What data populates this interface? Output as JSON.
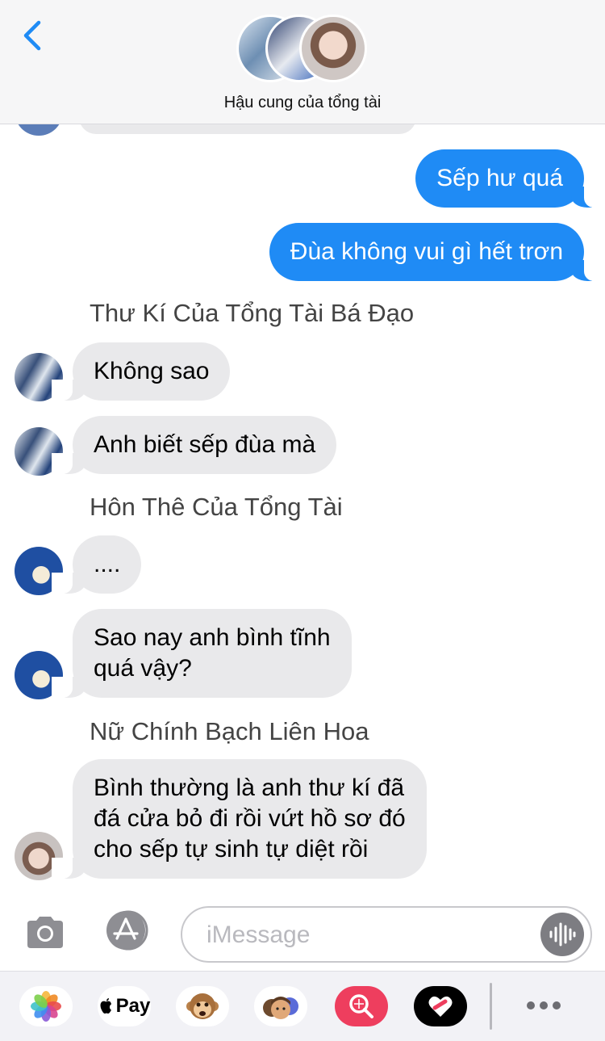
{
  "header": {
    "title": "Hậu cung của tổng tài",
    "back_icon": "chevron-left-icon",
    "accent_color": "#1f8bf5"
  },
  "messages": {
    "sent_1": "Sếp hư quá",
    "sent_2": "Đùa không vui gì hết trơn",
    "sender_1": "Thư Kí Của Tổng Tài Bá Đạo",
    "recv_1": "Không sao",
    "recv_2": "Anh biết sếp đùa mà",
    "sender_2": "Hôn Thê Của Tổng Tài",
    "recv_3": "....",
    "recv_4_line1": "Sao nay anh bình tĩnh",
    "recv_4_line2": "quá vậy?",
    "sender_3": "Nữ Chính Bạch Liên Hoa",
    "recv_5_line1": "Bình thường là anh thư kí đã",
    "recv_5_line2": "đá cửa bỏ đi rồi vứt hồ sơ đó",
    "recv_5_line3": "cho sếp tự sinh tự diệt rồi"
  },
  "input": {
    "placeholder": "iMessage",
    "camera_icon": "camera-icon",
    "apps_icon": "app-store-icon",
    "audio_icon": "audio-waveform-icon"
  },
  "drawer": {
    "apps": [
      "photos-icon",
      "apple-pay-icon",
      "animoji-monkey-icon",
      "memoji-icon",
      "image-search-icon",
      "digital-touch-icon"
    ],
    "apple_pay_label": "Pay",
    "more_icon": "more-icon"
  },
  "colors": {
    "sent_bubble": "#1f8bf5",
    "received_bubble": "#e9e9eb"
  }
}
